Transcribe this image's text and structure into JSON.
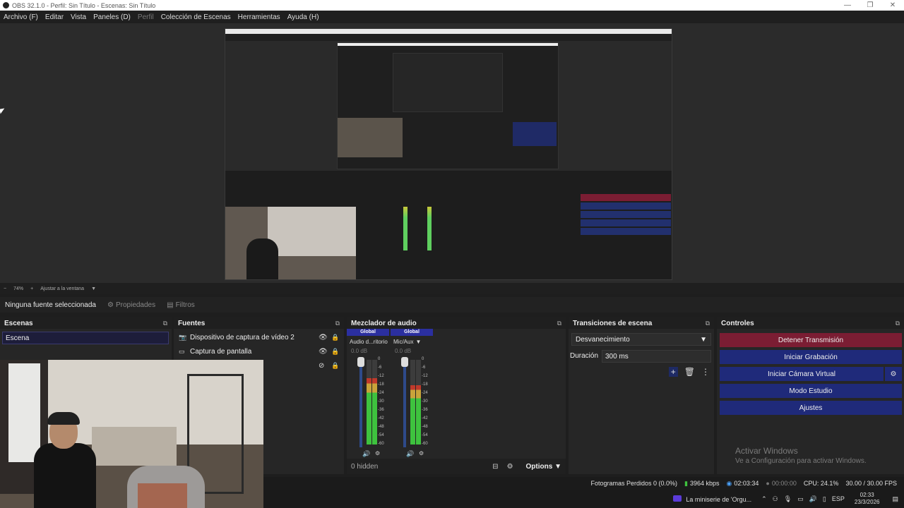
{
  "window": {
    "title": "OBS 32.1.0 - Perfil: Sin Título - Escenas: Sin Título"
  },
  "menu": [
    {
      "label": "Archivo (F)"
    },
    {
      "label": "Editar"
    },
    {
      "label": "Vista"
    },
    {
      "label": "Paneles (D)"
    },
    {
      "label": "Perfil"
    },
    {
      "label": "Colección de Escenas"
    },
    {
      "label": "Herramientas"
    },
    {
      "label": "Ayuda (H)"
    }
  ],
  "zoom": {
    "minus": "−",
    "value": "74%",
    "plus": "+",
    "fit": "Ajustar a la ventana"
  },
  "props": {
    "no_selection": "Ninguna fuente seleccionada",
    "properties": "Propiedades",
    "filters": "Filtros"
  },
  "scenes": {
    "title": "Escenas",
    "items": [
      "Escena"
    ]
  },
  "sources": {
    "title": "Fuentes",
    "items": [
      {
        "label": "Dispositivo de captura de vídeo 2",
        "icon": "camera-icon"
      },
      {
        "label": "Captura de pantalla",
        "icon": "monitor-icon"
      },
      {
        "label": "",
        "icon": ""
      }
    ]
  },
  "mixer": {
    "title": "Mezclador de audio",
    "global": "Global",
    "channels": [
      {
        "name": "Audio d...ritorio",
        "db": "0.0 dB",
        "level": 0.78
      },
      {
        "name": "Mic/Aux",
        "db": "0.0 dB",
        "level": 0.7
      }
    ],
    "scale": [
      "0",
      "-6",
      "-12",
      "-18",
      "-24",
      "-30",
      "-36",
      "-42",
      "-48",
      "-54",
      "-60"
    ],
    "hidden": "0 hidden",
    "options": "Options"
  },
  "transitions": {
    "title": "Transiciones de escena",
    "selected": "Desvanecimiento",
    "duration_label": "Duración",
    "duration_value": "300 ms"
  },
  "controls": {
    "title": "Controles",
    "stop_stream": "Detener Transmisión",
    "start_record": "Iniciar Grabación",
    "start_vcam": "Iniciar Cámara Virtual",
    "studio_mode": "Modo Estudio",
    "settings": "Ajustes"
  },
  "watermark": {
    "line1": "Activar Windows",
    "line2": "Ve a Configuración para activar Windows."
  },
  "status": {
    "dropped": "Fotogramas Perdidos 0 (0.0%)",
    "bitrate": "3964 kbps",
    "stream_time": "02:03:34",
    "rec_time": "00:00:00",
    "cpu": "CPU: 24.1%",
    "fps": "30.00 / 30.00 FPS"
  },
  "taskbar": {
    "media": "La miniserie de 'Orgu...",
    "lang": "ESP",
    "time": "02:33",
    "date": "23/3/2026"
  },
  "colors": {
    "accent": "#1f2a7a",
    "stop": "#7b1d33",
    "meter_green": "#3ec23e"
  }
}
